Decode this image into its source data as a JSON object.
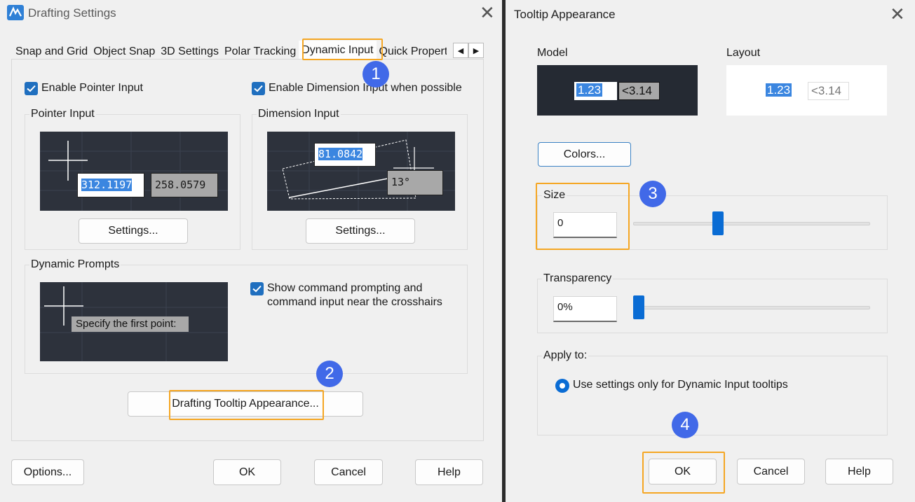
{
  "left_window": {
    "title": "Drafting Settings",
    "tabs": [
      "Snap and Grid",
      "Object Snap",
      "3D Settings",
      "Polar Tracking",
      "Dynamic Input",
      "Quick Propert"
    ],
    "enable_pointer_input": "Enable Pointer Input",
    "enable_dimension_input": "Enable Dimension Input when possible",
    "pointer_input": {
      "label": "Pointer Input",
      "value_x": "312.1197",
      "value_y": "258.0579",
      "settings_button": "Settings..."
    },
    "dimension_input": {
      "label": "Dimension Input",
      "length_value": "81.0842",
      "angle_value": "13°",
      "settings_button": "Settings..."
    },
    "dynamic_prompts": {
      "label": "Dynamic Prompts",
      "prompt_text": "Specify the first point:",
      "show_prompting_line1": "Show command prompting and",
      "show_prompting_line2": "command input near the crosshairs"
    },
    "tooltip_appearance_button": "Drafting Tooltip Appearance...",
    "options_button": "Options...",
    "ok_button": "OK",
    "cancel_button": "Cancel",
    "help_button": "Help"
  },
  "right_window": {
    "title": "Tooltip Appearance",
    "model_label": "Model",
    "layout_label": "Layout",
    "model_value": "1.23",
    "model_angle": "<3.14",
    "layout_value": "1.23",
    "layout_angle": "<3.14",
    "colors_button": "Colors...",
    "size_label": "Size",
    "size_value": "0",
    "size_slider_level": 0.35,
    "transparency_label": "Transparency",
    "transparency_value": "0%",
    "transparency_slider_level": 0.0,
    "apply_to_label": "Apply to:",
    "apply_option": "Use settings only for Dynamic Input tooltips",
    "ok_button": "OK",
    "cancel_button": "Cancel",
    "help_button": "Help"
  },
  "step_badges": [
    "1",
    "2",
    "3",
    "4"
  ],
  "colors": {
    "highlight": "#f5a623",
    "badge": "#4169e8",
    "accent": "#1f6fbf",
    "preview_bg": "#2d323c"
  },
  "icons": [
    "app-logo-icon",
    "close-icon",
    "scroll-left-icon",
    "scroll-right-icon",
    "checkmark-icon",
    "crosshair-icon"
  ]
}
